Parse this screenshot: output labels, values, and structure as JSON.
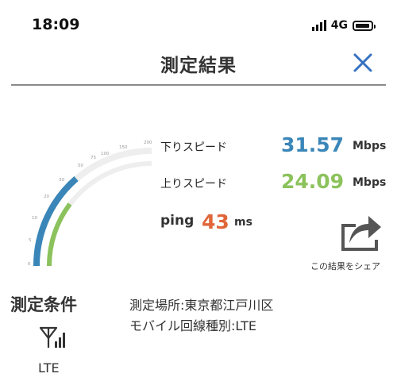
{
  "status_bar": {
    "time": "18:09",
    "network": "4G"
  },
  "header": {
    "title": "測定結果"
  },
  "gauge": {
    "ticks": [
      "0",
      "5",
      "10",
      "20",
      "30",
      "50",
      "75",
      "100",
      "150",
      "200",
      "150"
    ]
  },
  "results": {
    "download": {
      "label": "下りスピード",
      "value": "31.57",
      "unit": "Mbps"
    },
    "upload": {
      "label": "上りスピード",
      "value": "24.09",
      "unit": "Mbps"
    },
    "ping": {
      "label": "ping",
      "value": "43",
      "unit": "ms"
    }
  },
  "share": {
    "label": "この結果をシェア"
  },
  "conditions": {
    "title": "測定条件",
    "location": "測定場所:東京都江戸川区",
    "line_type": "モバイル回線種別:LTE",
    "network_label": "LTE"
  },
  "colors": {
    "download": "#3a86b8",
    "upload": "#8cc25c",
    "ping": "#e0663a",
    "close": "#3572c2"
  }
}
